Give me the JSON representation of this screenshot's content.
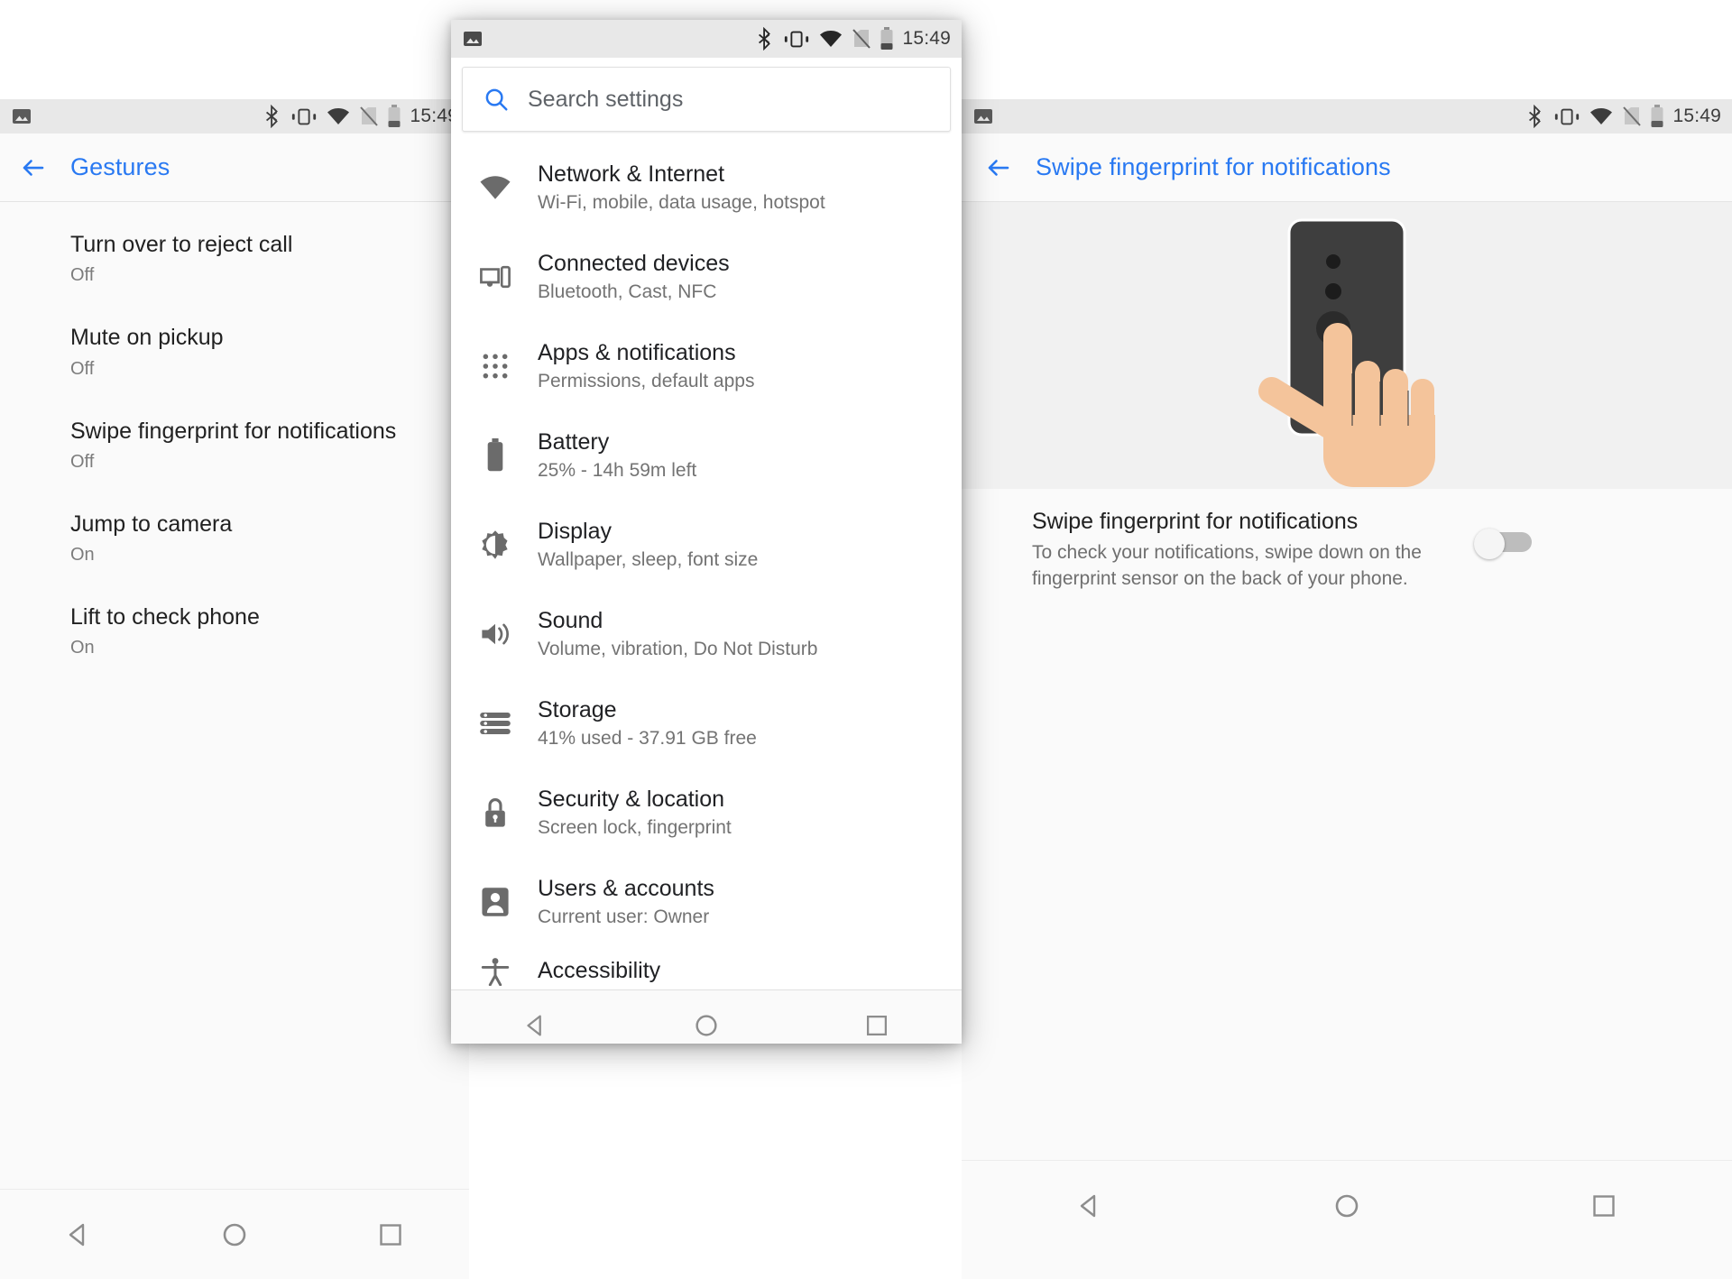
{
  "status_bar": {
    "time": "15:49",
    "icons": [
      "image-icon",
      "bluetooth-icon",
      "vibrate-icon",
      "wifi-icon",
      "sim-off-icon",
      "battery-icon"
    ]
  },
  "nav_bar": {
    "back_label": "back-nav-button",
    "home_label": "home-nav-button",
    "recents_label": "recents-nav-button"
  },
  "left_panel": {
    "title": "Gestures",
    "items": [
      {
        "title": "Turn over to reject call",
        "value": "Off"
      },
      {
        "title": "Mute on pickup",
        "value": "Off"
      },
      {
        "title": "Swipe fingerprint for notifications",
        "value": "Off"
      },
      {
        "title": "Jump to camera",
        "value": "On"
      },
      {
        "title": "Lift to check phone",
        "value": "On"
      }
    ]
  },
  "center_panel": {
    "search": {
      "placeholder": "Search settings",
      "value": ""
    },
    "items": [
      {
        "icon": "wifi-icon",
        "title": "Network & Internet",
        "subtitle": "Wi-Fi, mobile, data usage, hotspot"
      },
      {
        "icon": "devices-icon",
        "title": "Connected devices",
        "subtitle": "Bluetooth, Cast, NFC"
      },
      {
        "icon": "apps-grid-icon",
        "title": "Apps & notifications",
        "subtitle": "Permissions, default apps"
      },
      {
        "icon": "battery-icon",
        "title": "Battery",
        "subtitle": "25% - 14h 59m left"
      },
      {
        "icon": "brightness-icon",
        "title": "Display",
        "subtitle": "Wallpaper, sleep, font size"
      },
      {
        "icon": "volume-icon",
        "title": "Sound",
        "subtitle": "Volume, vibration, Do Not Disturb"
      },
      {
        "icon": "storage-icon",
        "title": "Storage",
        "subtitle": "41% used - 37.91 GB free"
      },
      {
        "icon": "lock-icon",
        "title": "Security & location",
        "subtitle": "Screen lock, fingerprint"
      },
      {
        "icon": "person-icon",
        "title": "Users & accounts",
        "subtitle": "Current user: Owner"
      },
      {
        "icon": "accessibility-icon",
        "title": "Accessibility",
        "subtitle": ""
      }
    ]
  },
  "right_panel": {
    "title": "Swipe fingerprint for notifications",
    "illustration": "phone-back-fingerprint-swipe-illustration",
    "pref_title": "Swipe fingerprint for notifications",
    "pref_description": "To check your notifications, swipe down on the fingerprint sensor on the back of your phone.",
    "toggle_state": "off"
  },
  "colors": {
    "accent": "#2979f2",
    "status_bar_bg": "#e8e8e8",
    "panel_bg": "#fafafa",
    "primary_text": "#212121",
    "secondary_text": "#737373"
  }
}
